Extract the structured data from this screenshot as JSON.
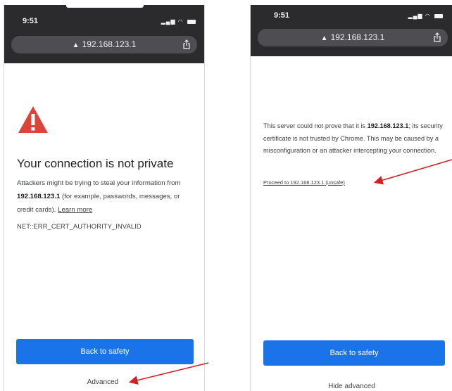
{
  "left": {
    "status_time": "9:51",
    "url": "192.168.123.1",
    "headline": "Your connection is not private",
    "body_prefix": "Attackers might be trying to steal your information from ",
    "body_host": "192.168.123.1",
    "body_suffix": " (for example, passwords, messages, or credit cards). ",
    "learn_more": "Learn more",
    "error_code": "NET::ERR_CERT_AUTHORITY_INVALID",
    "back_button": "Back to safety",
    "advanced": "Advanced"
  },
  "right": {
    "status_time": "9:51",
    "url": "192.168.123.1",
    "details_prefix": "This server could not prove that it is ",
    "details_host": "192.168.123.1",
    "details_suffix": "; its security certificate is not trusted by Chrome. This may be caused by a misconfiguration or an attacker intercepting your connection.",
    "proceed_link": "Proceed to 192.168.123.1 (unsafe)",
    "back_button": "Back to safety",
    "hide_advanced": "Hide advanced"
  },
  "icons": {
    "warning": "warning-triangle-icon",
    "share": "share-icon",
    "lock_warning": "not-secure-icon",
    "signal": "signal-icon",
    "wifi": "wifi-icon",
    "battery": "battery-icon"
  },
  "colors": {
    "warning_red": "#db4437",
    "button_blue": "#1a73e8",
    "annotation_arrow": "#d21f26",
    "status_bar": "#2b2b2d",
    "url_bar": "#4d4d52"
  }
}
